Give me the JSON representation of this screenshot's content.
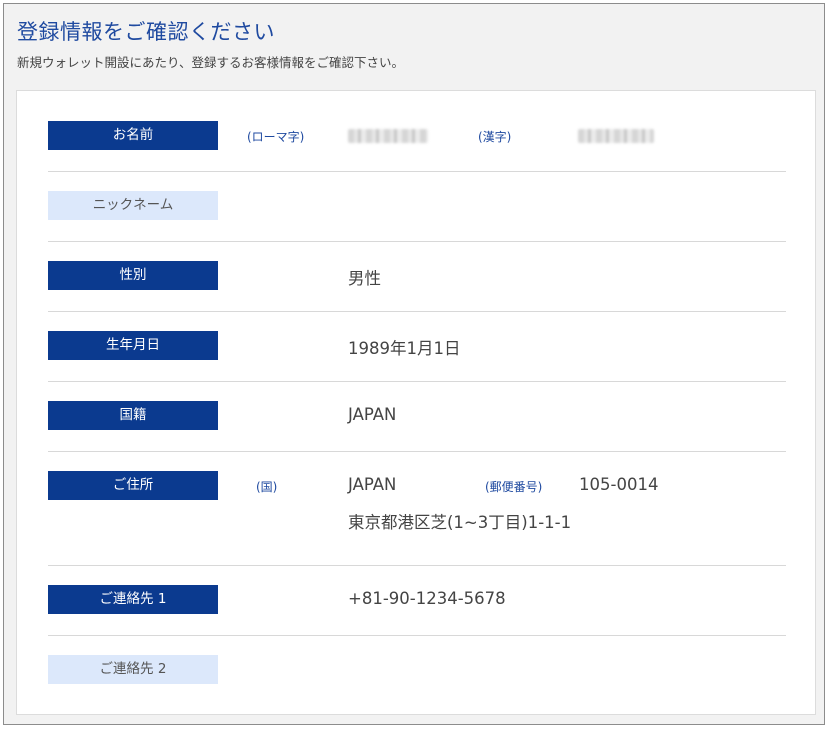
{
  "header": {
    "title": "登録情報をご確認ください",
    "subtitle": "新規ウォレット開設にあたり、登録するお客様情報をご確認下さい。"
  },
  "rows": {
    "name": {
      "label": "お名前",
      "roman_label": "(ローマ字)",
      "kanji_label": "(漢字)"
    },
    "nickname": {
      "label": "ニックネーム"
    },
    "gender": {
      "label": "性別",
      "value": "男性"
    },
    "birthdate": {
      "label": "生年月日",
      "value": "1989年1月1日"
    },
    "nationality": {
      "label": "国籍",
      "value": "JAPAN"
    },
    "address": {
      "label": "ご住所",
      "country_label": "(国)",
      "country_value": "JAPAN",
      "postal_label": "(郵便番号)",
      "postal_value": "105-0014",
      "street": "東京都港区芝(1~3丁目)1-1-1"
    },
    "contact1": {
      "label": "ご連絡先 1",
      "value": "+81-90-1234-5678"
    },
    "contact2": {
      "label": "ご連絡先 2"
    }
  }
}
